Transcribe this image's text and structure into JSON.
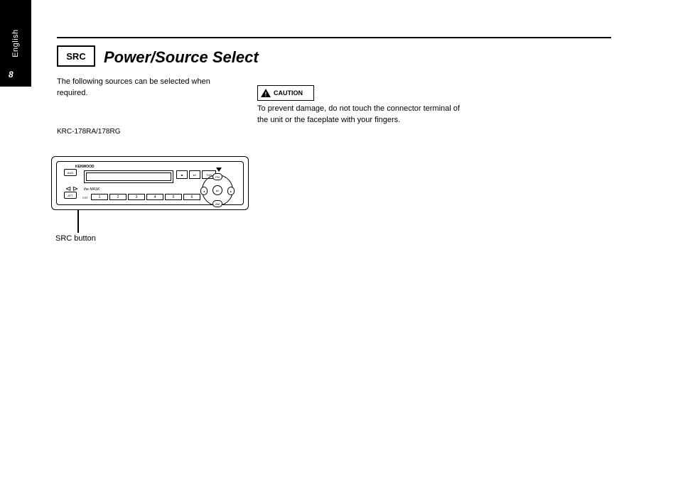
{
  "sidebar": {
    "label": "English",
    "page_number": "8"
  },
  "header": {
    "badge": "SRC",
    "title": "Power/Source Select"
  },
  "left": {
    "intro": "The following sources can be selected when required.",
    "diagram_note": "KRC-178RA/178RG",
    "callout": "SRC button"
  },
  "diagram": {
    "brand": "KENWOOD",
    "left_btn_top": "AUD",
    "left_btn_bot": "ATT",
    "cst": "CST",
    "mask": "the MASK",
    "upper_buttons": [
      "◂▸",
      "▸‖",
      "TUN"
    ],
    "dpad": {
      "fm": "FM",
      "am": "AM",
      "l": "◂",
      "r": "▸",
      "center": "▸‖"
    },
    "presets": [
      "1",
      "2",
      "3",
      "4",
      "5",
      "6"
    ]
  },
  "right": {
    "caution_label": "CAUTION",
    "paragraph": "To prevent damage, do not touch the connector terminal of the unit or the faceplate with your fingers."
  }
}
